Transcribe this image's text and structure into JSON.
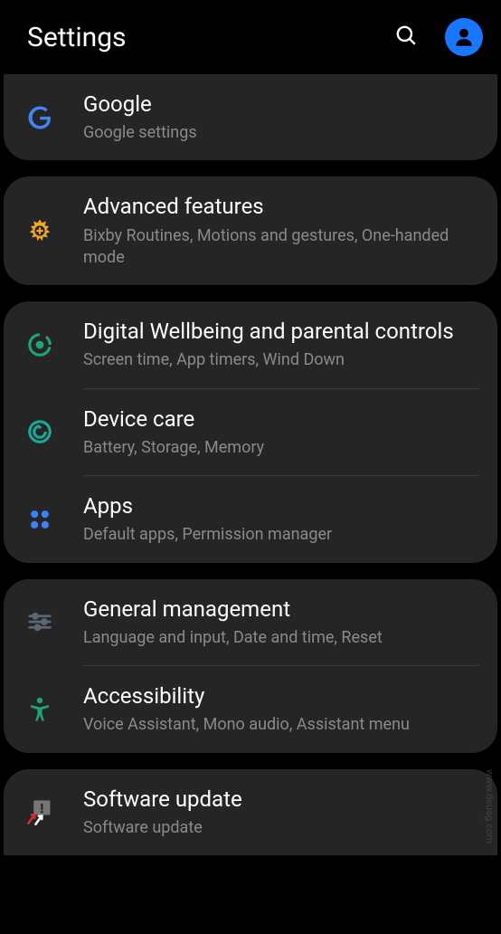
{
  "header": {
    "title": "Settings"
  },
  "groups": [
    {
      "items": [
        {
          "title": "Google",
          "subtitle": "Google settings"
        }
      ]
    },
    {
      "items": [
        {
          "title": "Advanced features",
          "subtitle": "Bixby Routines, Motions and gestures, One-handed mode"
        }
      ]
    },
    {
      "items": [
        {
          "title": "Digital Wellbeing and parental controls",
          "subtitle": "Screen time, App timers, Wind Down"
        },
        {
          "title": "Device care",
          "subtitle": "Battery, Storage, Memory"
        },
        {
          "title": "Apps",
          "subtitle": "Default apps, Permission manager"
        }
      ]
    },
    {
      "items": [
        {
          "title": "General management",
          "subtitle": "Language and input, Date and time, Reset"
        },
        {
          "title": "Accessibility",
          "subtitle": "Voice Assistant, Mono audio, Assistant menu"
        }
      ]
    },
    {
      "items": [
        {
          "title": "Software update",
          "subtitle": "Software update"
        }
      ]
    }
  ],
  "watermark": "www.deuag.com"
}
